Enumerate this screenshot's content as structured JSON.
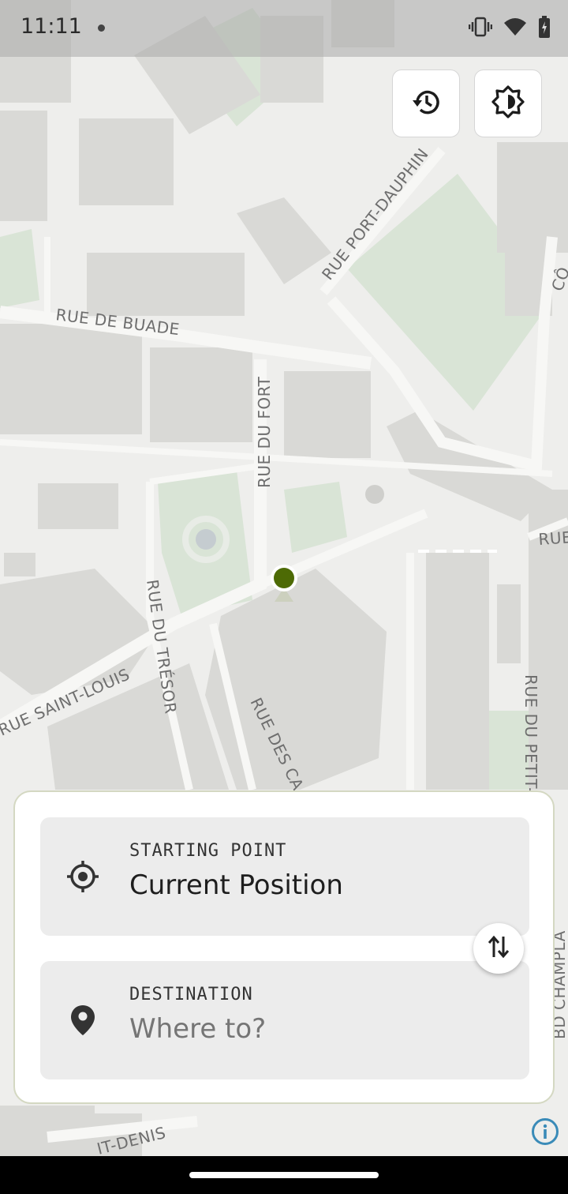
{
  "status_bar": {
    "time": "11:11"
  },
  "map": {
    "street_labels": [
      "RUE DE BUADE",
      "RUE PORT-DAUPHIN",
      "RUE DU FORT",
      "RUE DU TRÉSOR",
      "RUE SAINT-LOUIS",
      "RUE DES CA",
      "RUE DU PETIT-",
      "RUE",
      "CÔ",
      "BD CHAMPLA",
      "IT-DENIS"
    ],
    "colors": {
      "background": "#eeeeec",
      "building": "#d9d9d6",
      "park": "#d9e4d6",
      "road": "#f7f7f5",
      "position_marker": "#4d6a05"
    }
  },
  "controls": {
    "history_icon": "history-icon",
    "theme_icon": "brightness-icon",
    "info_icon": "info-icon"
  },
  "route_panel": {
    "start": {
      "label": "STARTING POINT",
      "value": "Current Position",
      "icon": "crosshair-icon"
    },
    "destination": {
      "label": "DESTINATION",
      "placeholder": "Where to?",
      "icon": "location-pin-icon"
    },
    "swap_icon": "swap-vertical-icon"
  }
}
